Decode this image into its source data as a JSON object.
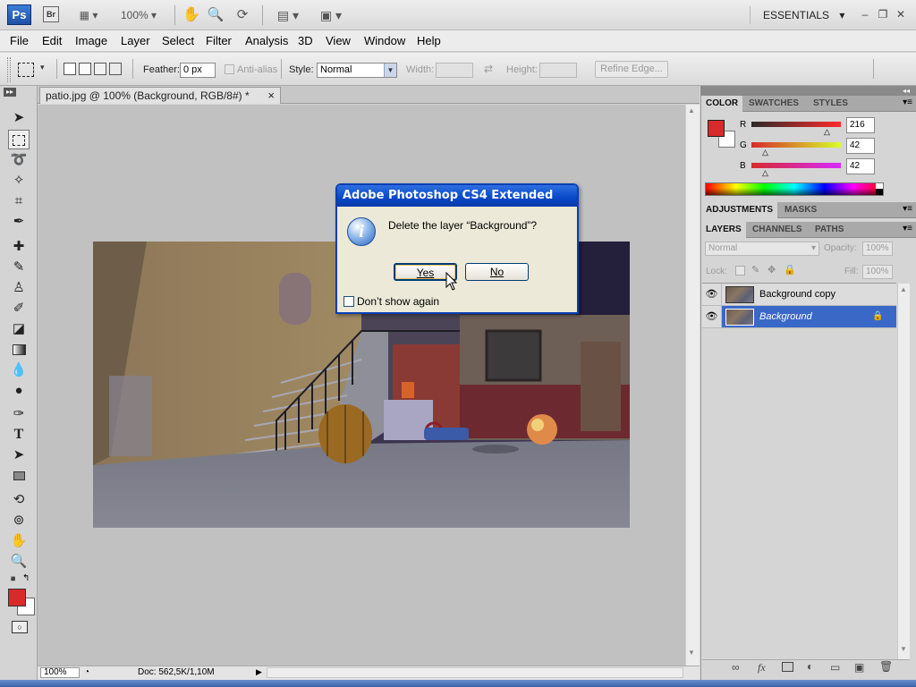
{
  "app": {
    "logo": "Ps",
    "bridge": "Br",
    "zoom": "100%",
    "workspace": "ESSENTIALS"
  },
  "menu": [
    "File",
    "Edit",
    "Image",
    "Layer",
    "Select",
    "Filter",
    "Analysis",
    "3D",
    "View",
    "Window",
    "Help"
  ],
  "options": {
    "feather_label": "Feather:",
    "feather_value": "0 px",
    "antialias_label": "Anti-alias",
    "style_label": "Style:",
    "style_value": "Normal",
    "width_label": "Width:",
    "height_label": "Height:",
    "refine_edge": "Refine Edge..."
  },
  "document": {
    "tab_title": "patio.jpg @ 100% (Background, RGB/8#) *",
    "close": "×",
    "status_zoom": "100%",
    "status_doc": "Doc: 562,5K/1,10M"
  },
  "color_panel": {
    "tabs": [
      "COLOR",
      "SWATCHES",
      "STYLES"
    ],
    "r_label": "R",
    "r_value": "216",
    "g_label": "G",
    "g_value": "42",
    "b_label": "B",
    "b_value": "42",
    "foreground": "#d82a2a",
    "background": "#ffffff"
  },
  "adjust_panel": {
    "tabs": [
      "ADJUSTMENTS",
      "MASKS"
    ]
  },
  "layers_panel": {
    "tabs": [
      "LAYERS",
      "CHANNELS",
      "PATHS"
    ],
    "blend_mode": "Normal",
    "opacity_label": "Opacity:",
    "opacity_value": "100%",
    "lock_label": "Lock:",
    "fill_label": "Fill:",
    "fill_value": "100%",
    "layers": [
      {
        "name": "Background copy",
        "selected": false
      },
      {
        "name": "Background",
        "selected": true
      }
    ]
  },
  "dialog": {
    "title": "Adobe Photoshop CS4 Extended",
    "message": "Delete the layer “Background”?",
    "yes": "Yes",
    "no": "No",
    "checkbox_label": "Don’t show again"
  },
  "tool_fg_color": "#d82a2a",
  "tool_bg_color": "#ffffff"
}
